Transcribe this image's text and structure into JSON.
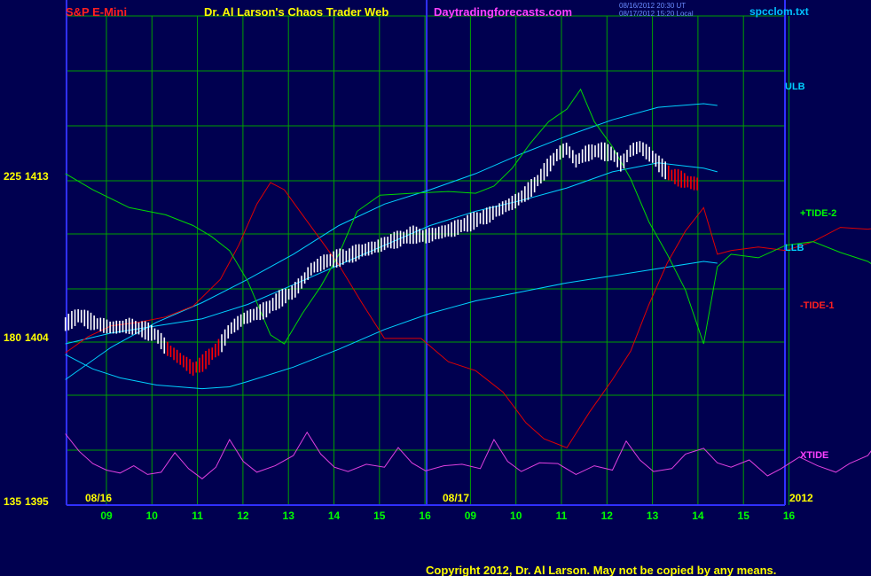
{
  "header": {
    "instrument": "S&P E-Mini",
    "title": "Dr. Al Larson's Chaos Trader Web",
    "site": "Daytradingforecasts.com",
    "stamp_line1": "08/16/2012 20:30 UT",
    "stamp_line2": "08/17/2012 15:20 Local",
    "file": "spcclom.txt"
  },
  "footer": {
    "copyright": "Copyright 2012, Dr. Al Larson. May not be copied by any means."
  },
  "colors": {
    "background": "#000050",
    "grid": "#00a000",
    "frame": "#3030ff",
    "price_up": "#ffffff",
    "price_down": "#ff0000",
    "band": "#00d0ff",
    "tide2": "#00d800",
    "tide1": "#e00000",
    "xtide": "#e040e0"
  },
  "chart_data": {
    "type": "line",
    "title": "",
    "y_axis_left": [
      {
        "tide": "225",
        "price": "1413"
      },
      {
        "tide": "180",
        "price": "1404"
      },
      {
        "tide": "135",
        "price": "1395"
      }
    ],
    "ylim_price": [
      1395,
      1413
    ],
    "x_hour_ticks": [
      "09",
      "10",
      "11",
      "12",
      "13",
      "14",
      "15",
      "16",
      "09",
      "10",
      "11",
      "12",
      "13",
      "14",
      "15",
      "16"
    ],
    "date_labels": [
      "08/16",
      "08/17"
    ],
    "year_label": "2012",
    "series_labels": [
      {
        "name": "ULB",
        "color": "#00d0ff"
      },
      {
        "name": "+TIDE-2",
        "color": "#00d800"
      },
      {
        "name": "LLB",
        "color": "#00d0ff"
      },
      {
        "name": "-TIDE-1",
        "color": "#e00000"
      },
      {
        "name": "XTIDE",
        "color": "#e040e0"
      }
    ],
    "price_path": [
      [
        0,
        1405.1
      ],
      [
        0.3,
        1405.6
      ],
      [
        0.6,
        1405.2
      ],
      [
        1.0,
        1404.9
      ],
      [
        1.4,
        1405.0
      ],
      [
        1.7,
        1404.8
      ],
      [
        2.0,
        1404.5
      ],
      [
        2.2,
        1403.8
      ],
      [
        2.5,
        1403.2
      ],
      [
        2.8,
        1402.6
      ],
      [
        3.0,
        1402.9
      ],
      [
        3.2,
        1403.4
      ],
      [
        3.4,
        1403.9
      ],
      [
        3.6,
        1404.8
      ],
      [
        3.9,
        1405.4
      ],
      [
        4.1,
        1405.6
      ],
      [
        4.4,
        1405.9
      ],
      [
        4.7,
        1406.5
      ],
      [
        5.0,
        1406.9
      ],
      [
        5.2,
        1407.5
      ],
      [
        5.4,
        1408.2
      ],
      [
        5.7,
        1408.6
      ],
      [
        6.0,
        1408.8
      ],
      [
        6.2,
        1408.9
      ],
      [
        6.5,
        1409.2
      ],
      [
        6.8,
        1409.4
      ],
      [
        7.1,
        1409.7
      ],
      [
        7.4,
        1409.9
      ],
      [
        7.6,
        1410.1
      ],
      [
        7.9,
        1410.0
      ],
      [
        8.2,
        1410.2
      ],
      [
        8.5,
        1410.4
      ],
      [
        8.8,
        1410.7
      ],
      [
        9.1,
        1411.0
      ],
      [
        9.3,
        1411.2
      ],
      [
        9.6,
        1411.6
      ],
      [
        9.9,
        1412.0
      ],
      [
        10.1,
        1412.4
      ],
      [
        10.3,
        1412.9
      ],
      [
        10.5,
        1413.6
      ],
      [
        10.8,
        1414.6
      ],
      [
        11.0,
        1414.9
      ],
      [
        11.2,
        1414.2
      ],
      [
        11.4,
        1414.6
      ],
      [
        11.7,
        1414.8
      ],
      [
        12.0,
        1414.6
      ],
      [
        12.2,
        1414.0
      ],
      [
        12.4,
        1414.8
      ],
      [
        12.6,
        1415.0
      ],
      [
        12.9,
        1414.4
      ],
      [
        13.1,
        1413.8
      ],
      [
        13.3,
        1413.4
      ],
      [
        13.5,
        1413.2
      ],
      [
        13.7,
        1413.0
      ],
      [
        13.9,
        1412.9
      ]
    ],
    "price_down_segments": [
      [
        2.2,
        3.4
      ],
      [
        13.2,
        13.9
      ]
    ],
    "ulb": [
      [
        0,
        1402.0
      ],
      [
        1,
        1403.8
      ],
      [
        2,
        1405.2
      ],
      [
        3,
        1406.3
      ],
      [
        4,
        1407.6
      ],
      [
        5,
        1409.0
      ],
      [
        6,
        1410.6
      ],
      [
        7,
        1411.8
      ],
      [
        8,
        1412.6
      ],
      [
        9,
        1413.5
      ],
      [
        10,
        1414.6
      ],
      [
        11,
        1415.6
      ],
      [
        12,
        1416.5
      ],
      [
        13,
        1417.2
      ],
      [
        14,
        1417.4
      ],
      [
        14.3,
        1417.3
      ]
    ],
    "band_mid": [
      [
        0,
        1404.0
      ],
      [
        1,
        1404.6
      ],
      [
        2,
        1405.0
      ],
      [
        3,
        1405.4
      ],
      [
        4,
        1406.2
      ],
      [
        5,
        1407.3
      ],
      [
        6,
        1408.4
      ],
      [
        7,
        1409.5
      ],
      [
        8,
        1410.6
      ],
      [
        9,
        1411.4
      ],
      [
        10,
        1412.0
      ],
      [
        11,
        1412.7
      ],
      [
        12,
        1413.6
      ],
      [
        13,
        1414.1
      ],
      [
        14,
        1413.8
      ],
      [
        14.3,
        1413.6
      ]
    ],
    "llb": [
      [
        0,
        1403.4
      ],
      [
        0.6,
        1402.6
      ],
      [
        1.2,
        1402.1
      ],
      [
        2,
        1401.7
      ],
      [
        3,
        1401.5
      ],
      [
        3.6,
        1401.6
      ],
      [
        4,
        1401.9
      ],
      [
        5,
        1402.7
      ],
      [
        6,
        1403.7
      ],
      [
        7,
        1404.8
      ],
      [
        8,
        1405.7
      ],
      [
        9,
        1406.4
      ],
      [
        10,
        1406.9
      ],
      [
        11,
        1407.4
      ],
      [
        12,
        1407.8
      ],
      [
        13,
        1408.2
      ],
      [
        14,
        1408.6
      ],
      [
        14.3,
        1408.5
      ]
    ],
    "tide2": [
      [
        0,
        1413.5
      ],
      [
        0.6,
        1412.6
      ],
      [
        1.4,
        1411.6
      ],
      [
        2.2,
        1411.2
      ],
      [
        2.8,
        1410.6
      ],
      [
        3.2,
        1410.0
      ],
      [
        3.6,
        1409.2
      ],
      [
        4.0,
        1407.5
      ],
      [
        4.5,
        1404.5
      ],
      [
        4.8,
        1404.0
      ],
      [
        5.2,
        1405.7
      ],
      [
        5.6,
        1407.2
      ],
      [
        6.0,
        1409.0
      ],
      [
        6.4,
        1411.4
      ],
      [
        6.9,
        1412.3
      ],
      [
        7.6,
        1412.4
      ],
      [
        8.4,
        1412.5
      ],
      [
        9.0,
        1412.4
      ],
      [
        9.4,
        1412.8
      ],
      [
        9.8,
        1413.8
      ],
      [
        10.2,
        1415.2
      ],
      [
        10.6,
        1416.4
      ],
      [
        11.0,
        1417.1
      ],
      [
        11.3,
        1418.2
      ],
      [
        11.6,
        1416.4
      ],
      [
        12.0,
        1415.0
      ],
      [
        12.4,
        1413.2
      ],
      [
        12.8,
        1410.8
      ],
      [
        13.2,
        1409.0
      ],
      [
        13.6,
        1407.0
      ],
      [
        14.0,
        1404.0
      ],
      [
        14.3,
        1408.3
      ],
      [
        14.6,
        1409.0
      ],
      [
        15.2,
        1408.8
      ],
      [
        15.8,
        1409.5
      ],
      [
        16.4,
        1409.7
      ],
      [
        17.0,
        1409.1
      ],
      [
        17.6,
        1408.6
      ],
      [
        18.2,
        1407.6
      ],
      [
        18.8,
        1407.7
      ],
      [
        19.4,
        1407.5
      ],
      [
        20.0,
        1408.1
      ],
      [
        20.6,
        1409.6
      ],
      [
        21.2,
        1411.2
      ],
      [
        21.8,
        1413.0
      ],
      [
        22.2,
        1414.2
      ],
      [
        22.6,
        1414.3
      ],
      [
        23.0,
        1413.8
      ],
      [
        23.4,
        1412.2
      ],
      [
        23.8,
        1409.6
      ],
      [
        24.2,
        1406.8
      ],
      [
        24.6,
        1403.8
      ],
      [
        25.0,
        1404.0
      ],
      [
        25.4,
        1404.8
      ],
      [
        25.8,
        1406.2
      ],
      [
        26.2,
        1407.8
      ],
      [
        26.6,
        1409.6
      ],
      [
        26.9,
        1410.5
      ]
    ],
    "tide1": [
      [
        0,
        1403.5
      ],
      [
        0.5,
        1404.4
      ],
      [
        1.0,
        1405.0
      ],
      [
        1.6,
        1405.2
      ],
      [
        2.2,
        1405.5
      ],
      [
        2.8,
        1406.1
      ],
      [
        3.4,
        1407.6
      ],
      [
        3.8,
        1409.5
      ],
      [
        4.2,
        1411.8
      ],
      [
        4.5,
        1413.0
      ],
      [
        4.8,
        1412.6
      ],
      [
        5.2,
        1411.2
      ],
      [
        5.6,
        1409.8
      ],
      [
        6.0,
        1408.4
      ],
      [
        6.5,
        1406.3
      ],
      [
        7.0,
        1404.3
      ],
      [
        7.8,
        1404.3
      ],
      [
        8.4,
        1403.0
      ],
      [
        9.0,
        1402.5
      ],
      [
        9.6,
        1401.3
      ],
      [
        10.1,
        1399.6
      ],
      [
        10.5,
        1398.7
      ],
      [
        11.0,
        1398.2
      ],
      [
        11.5,
        1400.2
      ],
      [
        12.0,
        1402.0
      ],
      [
        12.4,
        1403.6
      ],
      [
        12.8,
        1406.2
      ],
      [
        13.2,
        1408.5
      ],
      [
        13.6,
        1410.3
      ],
      [
        14.0,
        1411.6
      ],
      [
        14.3,
        1409.0
      ],
      [
        14.6,
        1409.2
      ],
      [
        15.2,
        1409.4
      ],
      [
        15.8,
        1409.2
      ],
      [
        16.4,
        1409.7
      ],
      [
        17.0,
        1410.5
      ],
      [
        17.6,
        1410.4
      ],
      [
        18.2,
        1410.6
      ],
      [
        18.8,
        1410.2
      ],
      [
        19.4,
        1409.6
      ],
      [
        20.0,
        1409.2
      ],
      [
        20.6,
        1407.8
      ],
      [
        21.2,
        1405.3
      ],
      [
        21.8,
        1403.4
      ],
      [
        22.2,
        1402.9
      ],
      [
        22.6,
        1403.0
      ],
      [
        23.0,
        1404.2
      ],
      [
        23.4,
        1407.2
      ],
      [
        23.8,
        1410.6
      ],
      [
        24.2,
        1413.2
      ],
      [
        24.6,
        1414.4
      ],
      [
        25.0,
        1413.8
      ],
      [
        25.4,
        1412.6
      ],
      [
        25.8,
        1411.2
      ],
      [
        26.2,
        1409.2
      ],
      [
        26.6,
        1407.3
      ],
      [
        26.9,
        1406.2
      ]
    ],
    "xtide_note": "oscillating magenta curve in lower band, values 0..1 within band",
    "xtide": [
      [
        0,
        0.86
      ],
      [
        0.3,
        0.62
      ],
      [
        0.6,
        0.45
      ],
      [
        0.9,
        0.36
      ],
      [
        1.2,
        0.32
      ],
      [
        1.5,
        0.42
      ],
      [
        1.8,
        0.3
      ],
      [
        2.1,
        0.33
      ],
      [
        2.4,
        0.6
      ],
      [
        2.7,
        0.38
      ],
      [
        3.0,
        0.24
      ],
      [
        3.3,
        0.4
      ],
      [
        3.6,
        0.78
      ],
      [
        3.9,
        0.48
      ],
      [
        4.2,
        0.33
      ],
      [
        4.6,
        0.42
      ],
      [
        5.0,
        0.56
      ],
      [
        5.3,
        0.88
      ],
      [
        5.6,
        0.58
      ],
      [
        5.9,
        0.4
      ],
      [
        6.2,
        0.34
      ],
      [
        6.6,
        0.44
      ],
      [
        7.0,
        0.4
      ],
      [
        7.3,
        0.67
      ],
      [
        7.6,
        0.46
      ],
      [
        7.9,
        0.35
      ],
      [
        8.3,
        0.42
      ],
      [
        8.7,
        0.44
      ],
      [
        9.1,
        0.38
      ],
      [
        9.4,
        0.78
      ],
      [
        9.7,
        0.48
      ],
      [
        10.0,
        0.34
      ],
      [
        10.4,
        0.46
      ],
      [
        10.8,
        0.45
      ],
      [
        11.2,
        0.3
      ],
      [
        11.6,
        0.42
      ],
      [
        12.0,
        0.36
      ],
      [
        12.3,
        0.76
      ],
      [
        12.6,
        0.5
      ],
      [
        12.9,
        0.34
      ],
      [
        13.3,
        0.38
      ],
      [
        13.6,
        0.58
      ],
      [
        14.0,
        0.66
      ],
      [
        14.3,
        0.46
      ],
      [
        14.6,
        0.4
      ],
      [
        15.0,
        0.5
      ],
      [
        15.4,
        0.28
      ],
      [
        15.7,
        0.38
      ],
      [
        16.1,
        0.54
      ],
      [
        16.5,
        0.42
      ],
      [
        16.9,
        0.33
      ],
      [
        17.2,
        0.45
      ],
      [
        17.6,
        0.56
      ],
      [
        17.9,
        0.82
      ],
      [
        18.2,
        0.48
      ],
      [
        18.5,
        0.44
      ],
      [
        18.9,
        0.34
      ],
      [
        19.3,
        0.38
      ],
      [
        19.7,
        0.28
      ],
      [
        20.0,
        0.44
      ],
      [
        20.3,
        0.78
      ],
      [
        20.6,
        0.52
      ],
      [
        21.0,
        0.34
      ],
      [
        21.4,
        0.44
      ],
      [
        21.8,
        0.32
      ],
      [
        22.2,
        0.4
      ],
      [
        22.6,
        0.62
      ],
      [
        23.0,
        0.34
      ],
      [
        23.3,
        0.42
      ],
      [
        23.6,
        0.88
      ],
      [
        23.9,
        0.54
      ],
      [
        24.2,
        0.36
      ],
      [
        24.6,
        0.4
      ],
      [
        25.0,
        0.58
      ],
      [
        25.3,
        0.36
      ],
      [
        25.7,
        0.44
      ],
      [
        26.0,
        0.34
      ],
      [
        26.3,
        0.8
      ],
      [
        26.5,
        0.92
      ],
      [
        26.7,
        0.52
      ],
      [
        26.9,
        0.42
      ]
    ]
  }
}
